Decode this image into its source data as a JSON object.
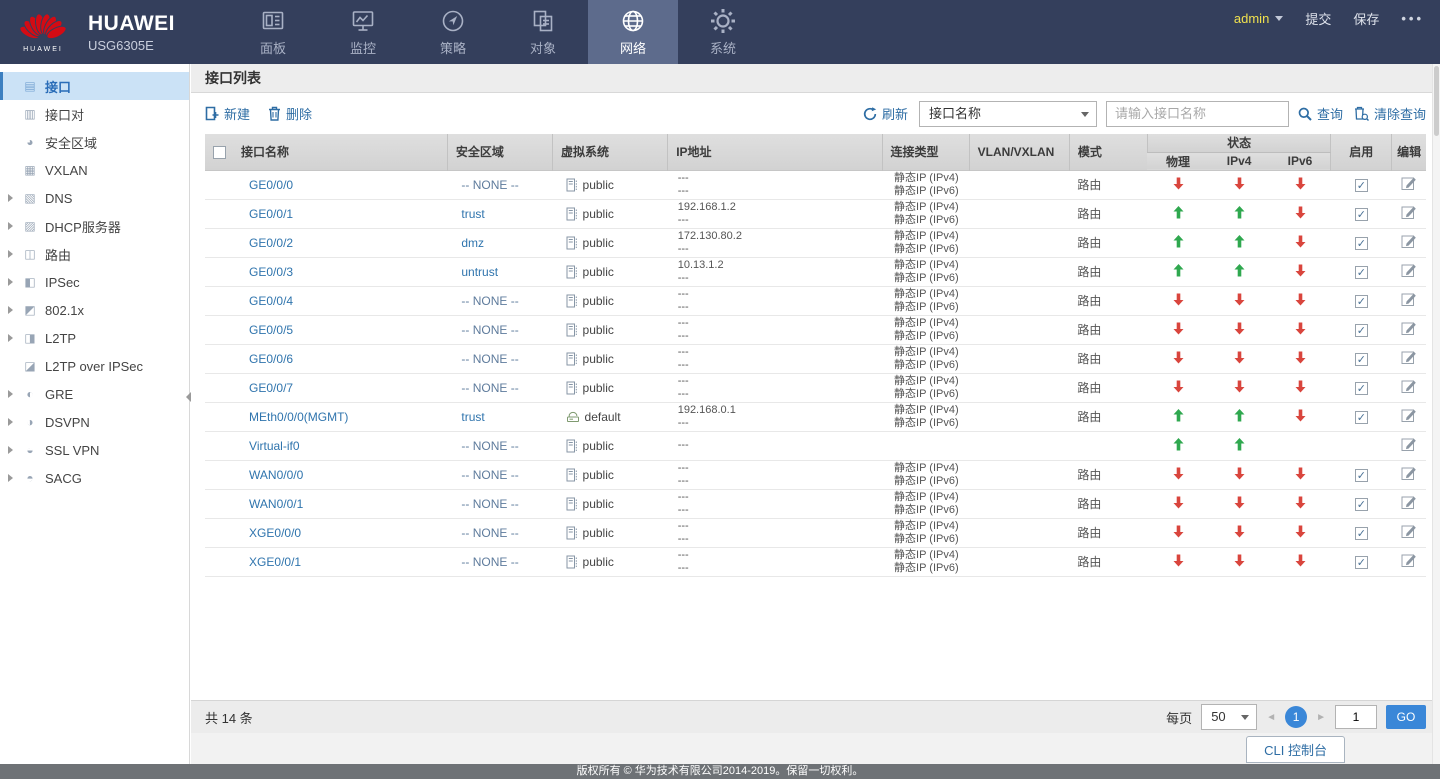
{
  "colors": {
    "navbar_bg": "#343f5c",
    "navbar_active_bg": "#5d6b8c",
    "brand_red": "#d40b14",
    "accent_blue": "#2e6da4",
    "link_blue": "#2f74ad",
    "selected_item_bg": "#cbe2f6",
    "status_up_green": "#2fa84f",
    "status_down_red": "#d9453d",
    "admin_yellow": "#f0e14e",
    "pagination_blue": "#3a87d8"
  },
  "topnav": {
    "brand": {
      "logo": "HUAWEI",
      "name": "HUAWEI",
      "model": "USG6305E"
    },
    "tabs": [
      {
        "id": "dashboard",
        "label": "面板",
        "icon": "dashboard-icon",
        "active": false
      },
      {
        "id": "monitor",
        "label": "监控",
        "icon": "monitor-icon",
        "active": false
      },
      {
        "id": "policy",
        "label": "策略",
        "icon": "policy-icon",
        "active": false
      },
      {
        "id": "object",
        "label": "对象",
        "icon": "object-icon",
        "active": false
      },
      {
        "id": "network",
        "label": "网络",
        "icon": "network-icon",
        "active": true
      },
      {
        "id": "system",
        "label": "系统",
        "icon": "system-icon",
        "active": false
      }
    ],
    "user": {
      "name": "admin"
    },
    "actions": {
      "commit": "提交",
      "save": "保存",
      "more": "•••"
    }
  },
  "sidebar": {
    "items": [
      {
        "id": "interface",
        "label": "接口",
        "icon": "interface-icon",
        "glyph": "▤",
        "expandable": false,
        "selected": true
      },
      {
        "id": "interface-pair",
        "label": "接口对",
        "icon": "interface-pair-icon",
        "glyph": "▥",
        "expandable": false,
        "selected": false
      },
      {
        "id": "security-zone",
        "label": "安全区域",
        "icon": "security-zone-icon",
        "glyph": "◕",
        "expandable": false,
        "selected": false
      },
      {
        "id": "vxlan",
        "label": "VXLAN",
        "icon": "vxlan-icon",
        "glyph": "▦",
        "expandable": false,
        "selected": false
      },
      {
        "id": "dns",
        "label": "DNS",
        "icon": "dns-icon",
        "glyph": "▧",
        "expandable": true,
        "selected": false
      },
      {
        "id": "dhcp-server",
        "label": "DHCP服务器",
        "icon": "dhcp-server-icon",
        "glyph": "▨",
        "expandable": true,
        "selected": false
      },
      {
        "id": "route",
        "label": "路由",
        "icon": "route-icon",
        "glyph": "◫",
        "expandable": true,
        "selected": false
      },
      {
        "id": "ipsec",
        "label": "IPSec",
        "icon": "ipsec-icon",
        "glyph": "◧",
        "expandable": true,
        "selected": false
      },
      {
        "id": "dot1x",
        "label": "802.1x",
        "icon": "802-1x-icon",
        "glyph": "◩",
        "expandable": true,
        "selected": false
      },
      {
        "id": "l2tp",
        "label": "L2TP",
        "icon": "l2tp-icon",
        "glyph": "◨",
        "expandable": true,
        "selected": false
      },
      {
        "id": "l2tp-over-ipsec",
        "label": "L2TP over IPSec",
        "icon": "l2tp-over-ipsec-icon",
        "glyph": "◪",
        "expandable": false,
        "selected": false
      },
      {
        "id": "gre",
        "label": "GRE",
        "icon": "gre-icon",
        "glyph": "◐",
        "expandable": true,
        "selected": false
      },
      {
        "id": "dsvpn",
        "label": "DSVPN",
        "icon": "dsvpn-icon",
        "glyph": "◑",
        "expandable": true,
        "selected": false
      },
      {
        "id": "ssl-vpn",
        "label": "SSL VPN",
        "icon": "ssl-vpn-icon",
        "glyph": "◒",
        "expandable": true,
        "selected": false
      },
      {
        "id": "sacg",
        "label": "SACG",
        "icon": "sacg-icon",
        "glyph": "◓",
        "expandable": true,
        "selected": false
      }
    ]
  },
  "page": {
    "title": "接口列表"
  },
  "toolbar": {
    "new_label": "新建",
    "delete_label": "删除",
    "refresh_label": "刷新",
    "filter_selected": "接口名称",
    "search_placeholder": "请输入接口名称",
    "query_label": "查询",
    "clear_query_label": "清除查询"
  },
  "table": {
    "columns": {
      "name": "接口名称",
      "zone": "安全区域",
      "vsys": "虚拟系统",
      "ip": "IP地址",
      "conn": "连接类型",
      "vlan": "VLAN/VXLAN",
      "mode": "模式",
      "status": "状态",
      "status_sub": [
        "物理",
        "IPv4",
        "IPv6"
      ],
      "enable": "启用",
      "edit": "编辑"
    },
    "rows": [
      {
        "name": "GE0/0/0",
        "zone": "-- NONE --",
        "zone_set": false,
        "vsys": "public",
        "vsys_icon": "vsys-public-icon",
        "ip": [
          "---",
          "---"
        ],
        "conn": [
          "静态IP (IPv4)",
          "静态IP (IPv6)"
        ],
        "vlan": "",
        "mode": "路由",
        "status": {
          "phy": "down",
          "ipv4": "down",
          "ipv6": "down"
        },
        "enabled": true
      },
      {
        "name": "GE0/0/1",
        "zone": "trust",
        "zone_set": true,
        "vsys": "public",
        "vsys_icon": "vsys-public-icon",
        "ip": [
          "192.168.1.2",
          "---"
        ],
        "conn": [
          "静态IP (IPv4)",
          "静态IP (IPv6)"
        ],
        "vlan": "",
        "mode": "路由",
        "status": {
          "phy": "up",
          "ipv4": "up",
          "ipv6": "down"
        },
        "enabled": true
      },
      {
        "name": "GE0/0/2",
        "zone": "dmz",
        "zone_set": true,
        "vsys": "public",
        "vsys_icon": "vsys-public-icon",
        "ip": [
          "172.130.80.2",
          "---"
        ],
        "conn": [
          "静态IP (IPv4)",
          "静态IP (IPv6)"
        ],
        "vlan": "",
        "mode": "路由",
        "status": {
          "phy": "up",
          "ipv4": "up",
          "ipv6": "down"
        },
        "enabled": true
      },
      {
        "name": "GE0/0/3",
        "zone": "untrust",
        "zone_set": true,
        "vsys": "public",
        "vsys_icon": "vsys-public-icon",
        "ip": [
          "10.13.1.2",
          "---"
        ],
        "conn": [
          "静态IP (IPv4)",
          "静态IP (IPv6)"
        ],
        "vlan": "",
        "mode": "路由",
        "status": {
          "phy": "up",
          "ipv4": "up",
          "ipv6": "down"
        },
        "enabled": true
      },
      {
        "name": "GE0/0/4",
        "zone": "-- NONE --",
        "zone_set": false,
        "vsys": "public",
        "vsys_icon": "vsys-public-icon",
        "ip": [
          "---",
          "---"
        ],
        "conn": [
          "静态IP (IPv4)",
          "静态IP (IPv6)"
        ],
        "vlan": "",
        "mode": "路由",
        "status": {
          "phy": "down",
          "ipv4": "down",
          "ipv6": "down"
        },
        "enabled": true
      },
      {
        "name": "GE0/0/5",
        "zone": "-- NONE --",
        "zone_set": false,
        "vsys": "public",
        "vsys_icon": "vsys-public-icon",
        "ip": [
          "---",
          "---"
        ],
        "conn": [
          "静态IP (IPv4)",
          "静态IP (IPv6)"
        ],
        "vlan": "",
        "mode": "路由",
        "status": {
          "phy": "down",
          "ipv4": "down",
          "ipv6": "down"
        },
        "enabled": true
      },
      {
        "name": "GE0/0/6",
        "zone": "-- NONE --",
        "zone_set": false,
        "vsys": "public",
        "vsys_icon": "vsys-public-icon",
        "ip": [
          "---",
          "---"
        ],
        "conn": [
          "静态IP (IPv4)",
          "静态IP (IPv6)"
        ],
        "vlan": "",
        "mode": "路由",
        "status": {
          "phy": "down",
          "ipv4": "down",
          "ipv6": "down"
        },
        "enabled": true
      },
      {
        "name": "GE0/0/7",
        "zone": "-- NONE --",
        "zone_set": false,
        "vsys": "public",
        "vsys_icon": "vsys-public-icon",
        "ip": [
          "---",
          "---"
        ],
        "conn": [
          "静态IP (IPv4)",
          "静态IP (IPv6)"
        ],
        "vlan": "",
        "mode": "路由",
        "status": {
          "phy": "down",
          "ipv4": "down",
          "ipv6": "down"
        },
        "enabled": true
      },
      {
        "name": "MEth0/0/0(MGMT)",
        "zone": "trust",
        "zone_set": true,
        "vsys": "default",
        "vsys_icon": "vsys-default-icon",
        "ip": [
          "192.168.0.1",
          "---"
        ],
        "conn": [
          "静态IP (IPv4)",
          "静态IP (IPv6)"
        ],
        "vlan": "",
        "mode": "路由",
        "status": {
          "phy": "up",
          "ipv4": "up",
          "ipv6": "down"
        },
        "enabled": true
      },
      {
        "name": "Virtual-if0",
        "zone": "-- NONE --",
        "zone_set": false,
        "vsys": "public",
        "vsys_icon": "vsys-public-icon",
        "ip": [
          "---"
        ],
        "conn": [],
        "vlan": "",
        "mode": "",
        "status": {
          "phy": "up",
          "ipv4": "up",
          "ipv6": ""
        },
        "enabled": null
      },
      {
        "name": "WAN0/0/0",
        "zone": "-- NONE --",
        "zone_set": false,
        "vsys": "public",
        "vsys_icon": "vsys-public-icon",
        "ip": [
          "---",
          "---"
        ],
        "conn": [
          "静态IP (IPv4)",
          "静态IP (IPv6)"
        ],
        "vlan": "",
        "mode": "路由",
        "status": {
          "phy": "down",
          "ipv4": "down",
          "ipv6": "down"
        },
        "enabled": true
      },
      {
        "name": "WAN0/0/1",
        "zone": "-- NONE --",
        "zone_set": false,
        "vsys": "public",
        "vsys_icon": "vsys-public-icon",
        "ip": [
          "---",
          "---"
        ],
        "conn": [
          "静态IP (IPv4)",
          "静态IP (IPv6)"
        ],
        "vlan": "",
        "mode": "路由",
        "status": {
          "phy": "down",
          "ipv4": "down",
          "ipv6": "down"
        },
        "enabled": true
      },
      {
        "name": "XGE0/0/0",
        "zone": "-- NONE --",
        "zone_set": false,
        "vsys": "public",
        "vsys_icon": "vsys-public-icon",
        "ip": [
          "---",
          "---"
        ],
        "conn": [
          "静态IP (IPv4)",
          "静态IP (IPv6)"
        ],
        "vlan": "",
        "mode": "路由",
        "status": {
          "phy": "down",
          "ipv4": "down",
          "ipv6": "down"
        },
        "enabled": true
      },
      {
        "name": "XGE0/0/1",
        "zone": "-- NONE --",
        "zone_set": false,
        "vsys": "public",
        "vsys_icon": "vsys-public-icon",
        "ip": [
          "---",
          "---"
        ],
        "conn": [
          "静态IP (IPv4)",
          "静态IP (IPv6)"
        ],
        "vlan": "",
        "mode": "路由",
        "status": {
          "phy": "down",
          "ipv4": "down",
          "ipv6": "down"
        },
        "enabled": true
      }
    ]
  },
  "pagination": {
    "total": "共 14 条",
    "per_page_label": "每页",
    "per_page": "50",
    "prev": "◄",
    "current": "1",
    "next": "►",
    "jump_value": "1",
    "go_label": "GO"
  },
  "cli_console": {
    "label": "CLI 控制台"
  },
  "footer": {
    "copyright": "版权所有 © 华为技术有限公司2014-2019。保留一切权利。"
  }
}
